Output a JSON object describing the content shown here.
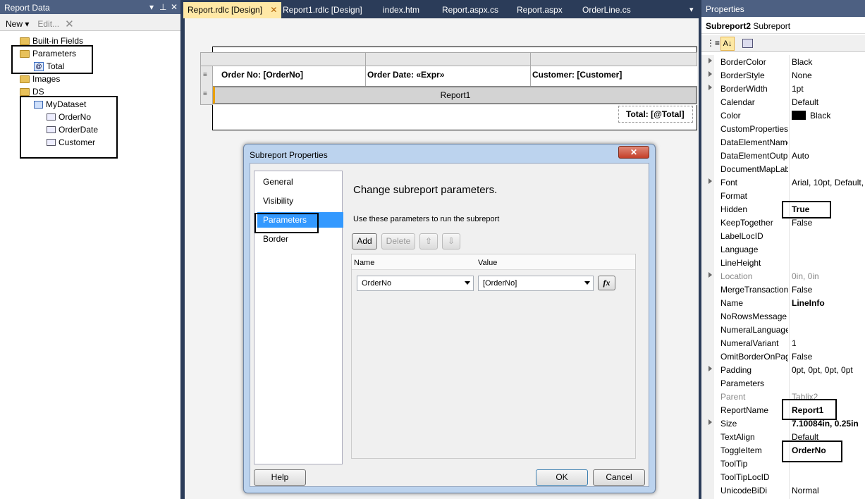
{
  "report_data": {
    "title": "Report Data",
    "toolbar": {
      "new": "New",
      "edit": "Edit..."
    },
    "tree": {
      "builtin": "Built-in Fields",
      "parameters": "Parameters",
      "param_total": "Total",
      "images": "Images",
      "ds": "DS",
      "dataset": "MyDataset",
      "fields": [
        "OrderNo",
        "OrderDate",
        "Customer"
      ]
    }
  },
  "tabs": [
    "Report.rdlc [Design]",
    "Report1.rdlc [Design]",
    "index.htm",
    "Report.aspx.cs",
    "Report.aspx",
    "OrderLine.cs"
  ],
  "report": {
    "order_no": "Order No: [OrderNo]",
    "order_date": "Order Date: «Expr»",
    "customer": "Customer: [Customer]",
    "subreport": "Report1",
    "total": "Total: [@Total]"
  },
  "dialog": {
    "title": "Subreport Properties",
    "nav": [
      "General",
      "Visibility",
      "Parameters",
      "Border"
    ],
    "heading": "Change subreport parameters.",
    "instruction": "Use these parameters to run the subreport",
    "add": "Add",
    "delete": "Delete",
    "col_name": "Name",
    "col_value": "Value",
    "param_name": "OrderNo",
    "param_value": "[OrderNo]",
    "fx": "fx",
    "help": "Help",
    "ok": "OK",
    "cancel": "Cancel"
  },
  "properties": {
    "title": "Properties",
    "object_name": "Subreport2",
    "object_type": "Subreport",
    "rows": [
      {
        "name": "BorderColor",
        "value": "Black"
      },
      {
        "name": "BorderStyle",
        "value": "None"
      },
      {
        "name": "BorderWidth",
        "value": "1pt"
      },
      {
        "name": "Calendar",
        "value": "Default"
      },
      {
        "name": "Color",
        "value": "Black"
      },
      {
        "name": "CustomProperties",
        "value": ""
      },
      {
        "name": "DataElementName",
        "value": ""
      },
      {
        "name": "DataElementOutput",
        "value": "Auto"
      },
      {
        "name": "DocumentMapLabel",
        "value": ""
      },
      {
        "name": "Font",
        "value": "Arial, 10pt, Default,"
      },
      {
        "name": "Format",
        "value": ""
      },
      {
        "name": "Hidden",
        "value": "True"
      },
      {
        "name": "KeepTogether",
        "value": "False"
      },
      {
        "name": "LabelLocID",
        "value": ""
      },
      {
        "name": "Language",
        "value": ""
      },
      {
        "name": "LineHeight",
        "value": ""
      },
      {
        "name": "Location",
        "value": "0in, 0in"
      },
      {
        "name": "MergeTransactions",
        "value": "False"
      },
      {
        "name": "Name",
        "value": "LineInfo"
      },
      {
        "name": "NoRowsMessage",
        "value": ""
      },
      {
        "name": "NumeralLanguage",
        "value": ""
      },
      {
        "name": "NumeralVariant",
        "value": "1"
      },
      {
        "name": "OmitBorderOnPageBreak",
        "value": "False"
      },
      {
        "name": "Padding",
        "value": "0pt, 0pt, 0pt, 0pt"
      },
      {
        "name": "Parameters",
        "value": ""
      },
      {
        "name": "Parent",
        "value": "Tablix2"
      },
      {
        "name": "ReportName",
        "value": "Report1"
      },
      {
        "name": "Size",
        "value": "7.10084in, 0.25in"
      },
      {
        "name": "TextAlign",
        "value": "Default"
      },
      {
        "name": "ToggleItem",
        "value": "OrderNo"
      },
      {
        "name": "ToolTip",
        "value": ""
      },
      {
        "name": "ToolTipLocID",
        "value": ""
      },
      {
        "name": "UnicodeBiDi",
        "value": "Normal"
      }
    ]
  }
}
